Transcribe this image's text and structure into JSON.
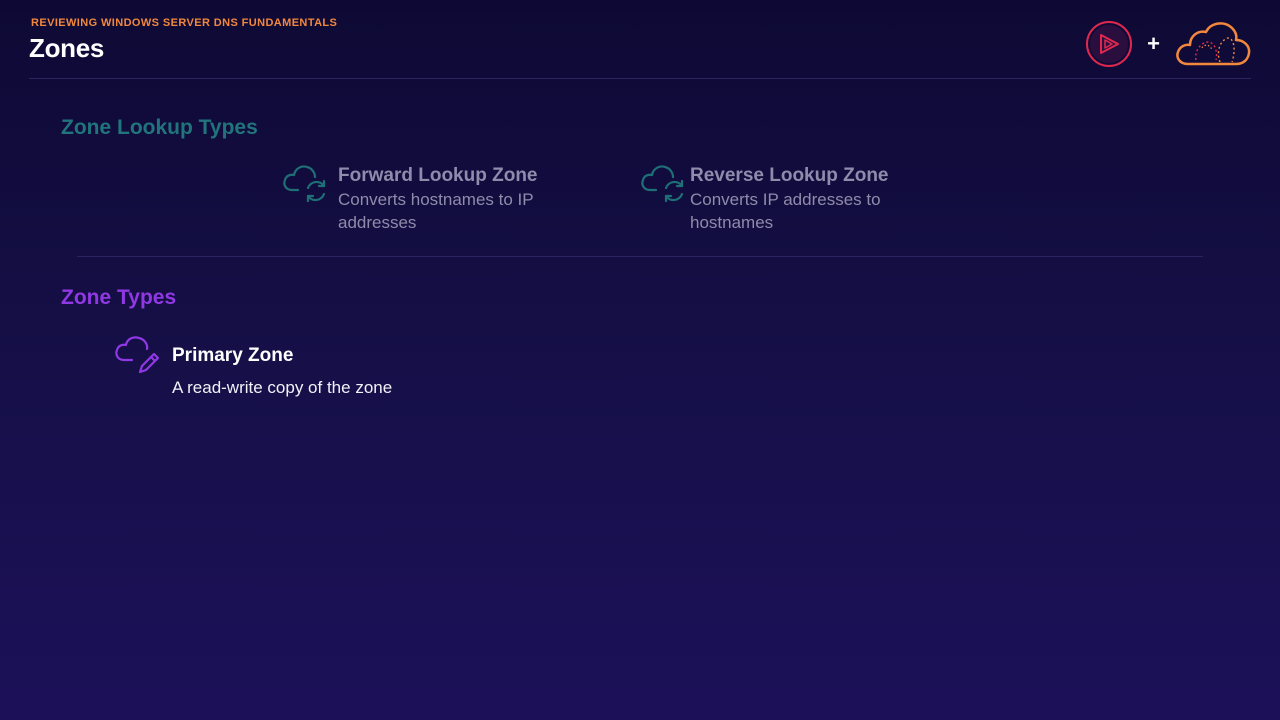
{
  "header": {
    "eyebrow": "REVIEWING WINDOWS SERVER DNS FUNDAMENTALS",
    "title": "Zones",
    "plus": "+"
  },
  "logos": {
    "left_logo_icon": "play-badge-icon",
    "right_logo_icon": "dotted-cloud-icon",
    "left_color": "#e0284f",
    "right_color": "#f1883d"
  },
  "lookup_section": {
    "title": "Zone Lookup Types",
    "color": "#21747b",
    "items": [
      {
        "icon": "cloud-refresh-icon",
        "name": "Forward Lookup Zone",
        "desc": "Converts hostnames to IP addresses"
      },
      {
        "icon": "cloud-refresh-icon",
        "name": "Reverse Lookup Zone",
        "desc": "Converts IP addresses to hostnames"
      }
    ]
  },
  "types_section": {
    "title": "Zone Types",
    "color": "#9038e4",
    "items": [
      {
        "icon": "cloud-pencil-icon",
        "name": "Primary Zone",
        "desc": "A read-write copy of the zone"
      }
    ]
  }
}
